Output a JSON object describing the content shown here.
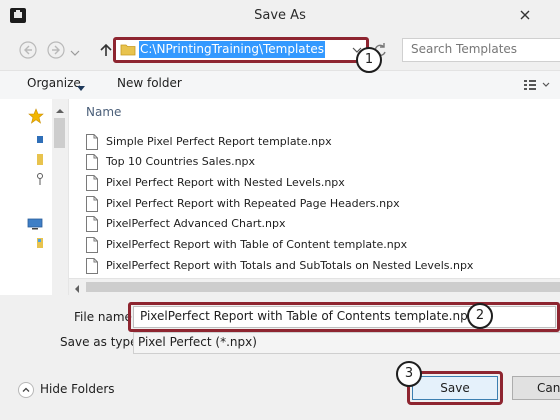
{
  "window": {
    "title": "Save As",
    "icons": {
      "app": "app-icon",
      "close": "close-icon"
    }
  },
  "address_bar": {
    "path": "C:\\NPrintingTraining\\Templates",
    "icons": {
      "back": "back-arrow-icon",
      "forward": "forward-arrow-icon",
      "up": "up-arrow-icon",
      "folder": "folder-icon",
      "dropdown": "chevron-down-icon",
      "refresh": "refresh-icon"
    }
  },
  "search": {
    "placeholder": "Search Templates",
    "icon": "search-icon"
  },
  "toolbar": {
    "organize_label": "Organize",
    "new_folder_label": "New folder",
    "view_icon": "view-options-icon"
  },
  "nav_pane": {
    "icons": [
      "star-icon",
      "desktop-icon",
      "folder-icon",
      "homegroup-icon",
      "computer-icon",
      "network-drive-icon"
    ]
  },
  "file_list": {
    "column_name": "Name",
    "files": [
      "Simple Pixel Perfect Report template.npx",
      "Top 10 Countries Sales.npx",
      "Pixel Perfect Report with Nested Levels.npx",
      "Pixel Perfect Report with Repeated Page Headers.npx",
      "PixelPerfect Advanced Chart.npx",
      "PixelPerfect Report with Table of Content template.npx",
      "PixelPerfect Report with Totals and SubTotals on Nested Levels.npx"
    ]
  },
  "form": {
    "file_name_label": "File name:",
    "file_name_value": "PixelPerfect Report with Table of Contents template.npx",
    "save_as_type_label": "Save as type:",
    "save_as_type_value": "Pixel Perfect (*.npx)"
  },
  "footer": {
    "hide_folders_label": "Hide Folders",
    "save_label": "Save",
    "cancel_label": "Can"
  },
  "callouts": {
    "one": "1",
    "two": "2",
    "three": "3"
  },
  "colors": {
    "highlight_border": "#8e2530",
    "selection": "#3399ff"
  }
}
